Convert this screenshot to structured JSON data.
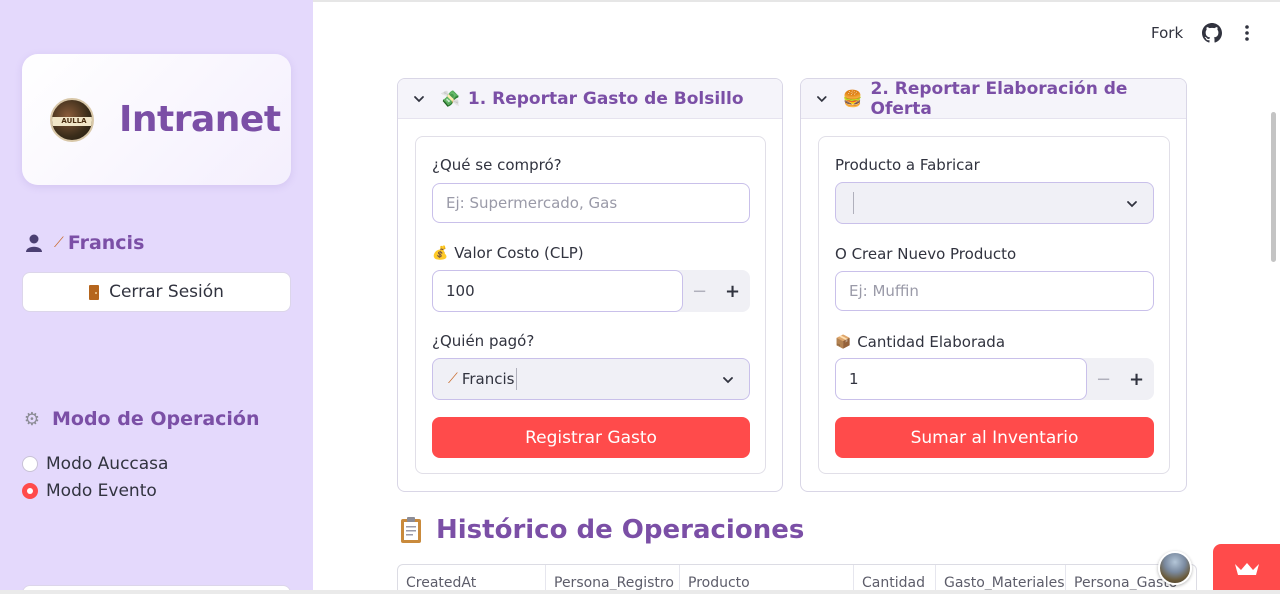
{
  "header": {
    "fork_label": "Fork"
  },
  "sidebar": {
    "logo_badge_text": "AULLA",
    "app_title": "Intranet",
    "user_name": "Francis",
    "logout_label": "Cerrar Sesión",
    "mode_title": "Modo de Operación",
    "modes": [
      {
        "label": "Modo Auccasa",
        "selected": false
      },
      {
        "label": "Modo Evento",
        "selected": true
      }
    ]
  },
  "expense": {
    "title": "1. Reportar Gasto de Bolsillo",
    "what_label": "¿Qué se compró?",
    "what_placeholder": "Ej: Supermercado, Gas",
    "cost_label": "Valor Costo (CLP)",
    "cost_value": "100",
    "payer_label": "¿Quién pagó?",
    "payer_value": "Francis",
    "submit_label": "Registrar Gasto"
  },
  "production": {
    "title": "2. Reportar Elaboración de Oferta",
    "product_label": "Producto a Fabricar",
    "product_value": "",
    "new_product_label": "O Crear Nuevo Producto",
    "new_product_placeholder": "Ej: Muffin",
    "qty_label": "Cantidad Elaborada",
    "qty_value": "1",
    "submit_label": "Sumar al Inventario"
  },
  "history": {
    "title": "Histórico de Operaciones",
    "columns": [
      "CreatedAt",
      "Persona_Registro",
      "Producto",
      "Cantidad",
      "Gasto_Materiales",
      "Persona_Gasto"
    ]
  },
  "colors": {
    "accent": "#7b4fa6",
    "primary_button": "#ff4b4b",
    "sidebar_bg": "#e4d9fc"
  }
}
